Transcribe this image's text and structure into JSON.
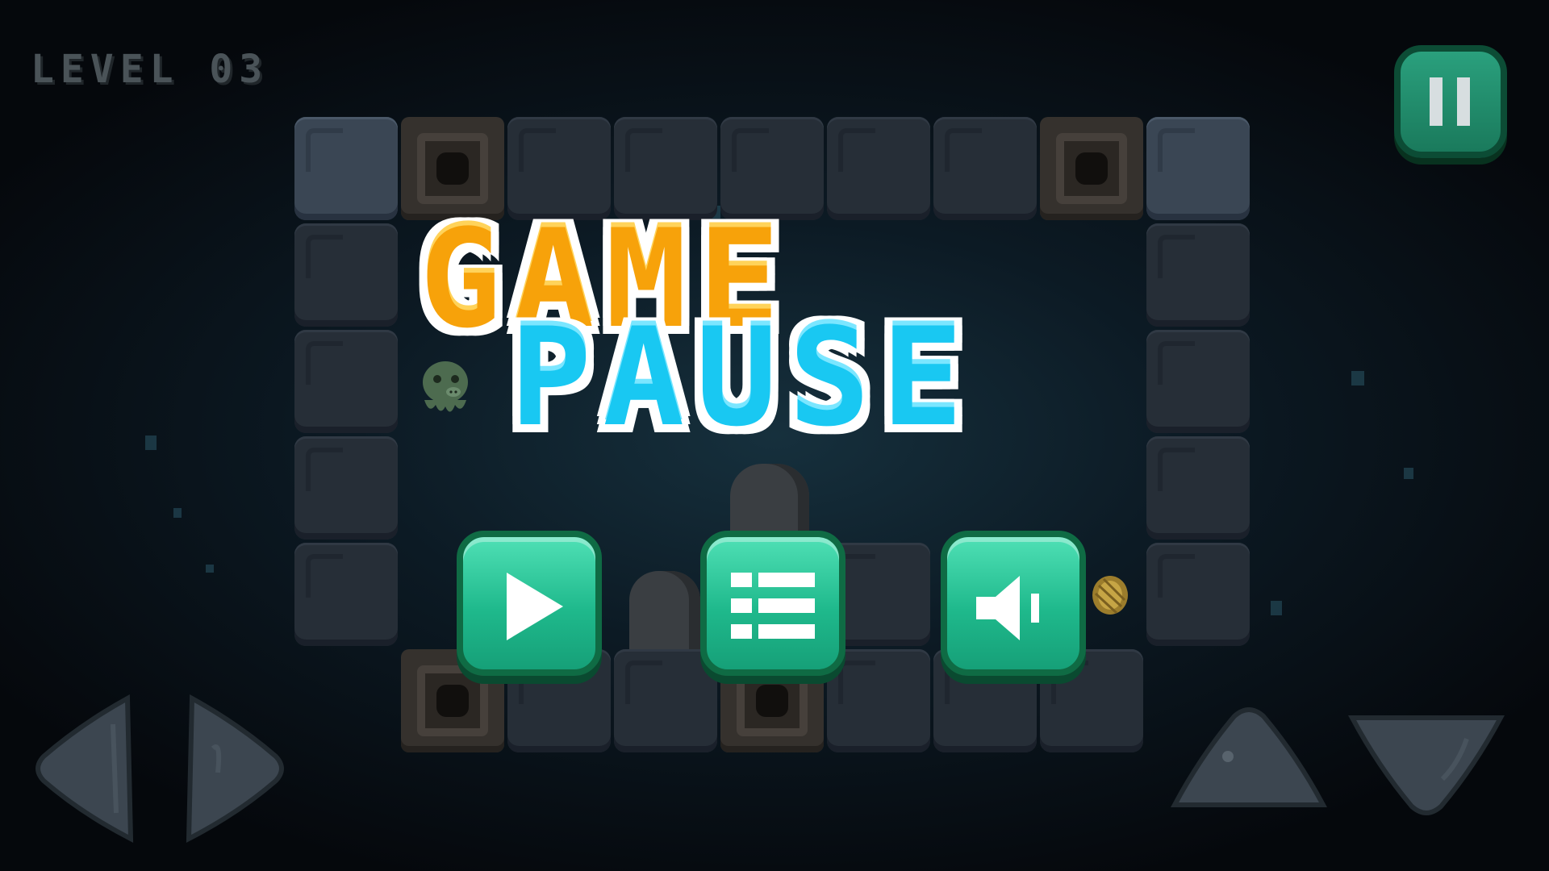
{
  "hud": {
    "level_label": "LEVEL 03"
  },
  "title": {
    "line1": "GAME",
    "line2": "PAUSE"
  },
  "pause_menu": {
    "buttons": [
      {
        "icon": "play-icon"
      },
      {
        "icon": "menu-list-icon"
      },
      {
        "icon": "sound-icon"
      }
    ]
  },
  "controls": {
    "left": "arrow-left-icon",
    "right": "arrow-right-icon",
    "up": "arrow-up-icon",
    "down": "arrow-down-icon",
    "pause": "pause-icon"
  },
  "colors": {
    "title_orange": "#f7a20a",
    "title_cyan": "#19c8f2",
    "button_green": "#1fb98c",
    "button_border": "#0f6b44"
  }
}
